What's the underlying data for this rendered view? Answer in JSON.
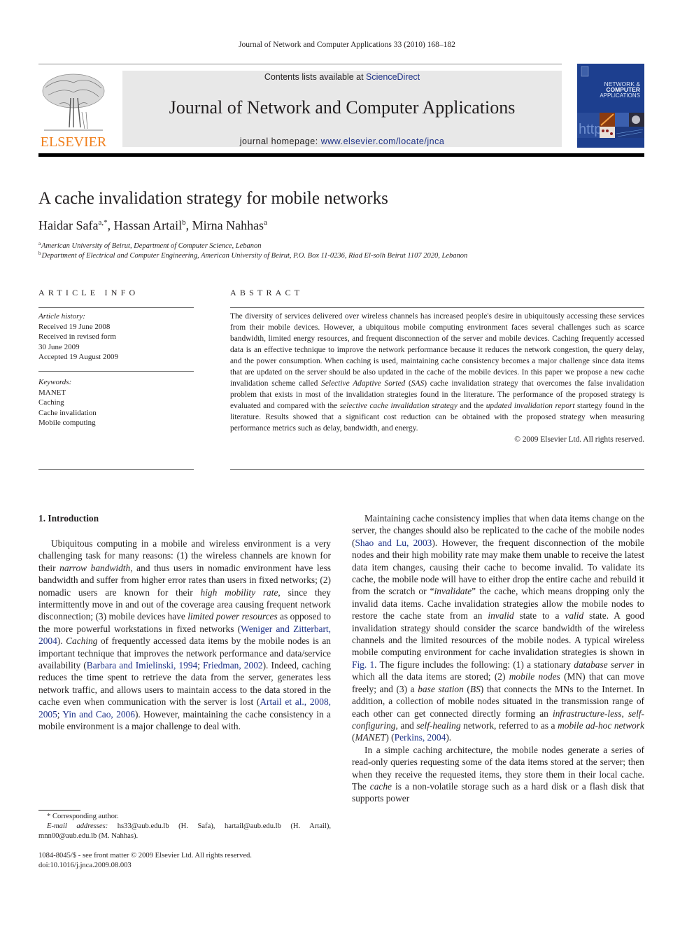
{
  "running_head": "Journal of Network and Computer Applications 33 (2010) 168–182",
  "masthead": {
    "publisher_logo_text": "ELSEVIER",
    "contents_prefix": "Contents lists available at ",
    "contents_link": "ScienceDirect",
    "journal_title": "Journal of Network and Computer Applications",
    "homepage_prefix": "journal homepage: ",
    "homepage_link": "www.elsevier.com/locate/jnca",
    "cover": {
      "line1": "NETWORK &",
      "line2": "COMPUTER",
      "line3": "APPLICATIONS"
    }
  },
  "article": {
    "title": "A cache invalidation strategy for mobile networks",
    "authors": [
      {
        "name": "Haidar Safa",
        "sup": "a,*",
        "sep": ", "
      },
      {
        "name": "Hassan Artail",
        "sup": "b",
        "sep": ", "
      },
      {
        "name": "Mirna Nahhas",
        "sup": "a",
        "sep": ""
      }
    ],
    "affiliations": [
      {
        "mark": "a",
        "text": "American University of Beirut, Department of Computer Science, Lebanon"
      },
      {
        "mark": "b",
        "text": "Department of Electrical and Computer Engineering, American University of Beirut, P.O. Box 11-0236, Riad El-solh Beirut 1107 2020, Lebanon"
      }
    ]
  },
  "article_info": {
    "heading": "ARTICLE INFO",
    "history_label": "Article history:",
    "history": [
      "Received 19 June 2008",
      "Received in revised form",
      "30 June 2009",
      "Accepted 19 August 2009"
    ],
    "keywords_label": "Keywords:",
    "keywords": [
      "MANET",
      "Caching",
      "Cache invalidation",
      "Mobile computing"
    ]
  },
  "abstract": {
    "heading": "ABSTRACT",
    "segments": [
      {
        "t": "The diversity of services delivered over wireless channels has increased people's desire in ubiquitously accessing these services from their mobile devices. However, a ubiquitous mobile computing environment faces several challenges such as scarce bandwidth, limited energy resources, and frequent disconnection of the server and mobile devices. Caching frequently accessed data is an effective technique to improve the network performance because it reduces the network congestion, the query delay, and the power consumption. When caching is used, maintaining cache consistency becomes a major challenge since data items that are updated on the server should be also updated in the cache of the mobile devices. In this paper we propose a new cache invalidation scheme called "
      },
      {
        "t": "Selective Adaptive Sorted",
        "i": true
      },
      {
        "t": " ("
      },
      {
        "t": "SAS",
        "i": true
      },
      {
        "t": ") cache invalidation strategy that overcomes the false invalidation problem that exists in most of the invalidation strategies found in the literature. The performance of the proposed strategy is evaluated and compared with the "
      },
      {
        "t": "selective cache invalidation strategy",
        "i": true
      },
      {
        "t": " and the "
      },
      {
        "t": "updated invalidation report",
        "i": true
      },
      {
        "t": " startegy found in the literature. Results showed that a significant cost reduction can be obtained with the proposed strategy when measuring performance metrics such as delay, bandwidth, and energy."
      }
    ],
    "copyright": "© 2009 Elsevier Ltd. All rights reserved."
  },
  "body": {
    "section_heading": "1.  Introduction",
    "left_paragraphs": [
      [
        {
          "t": "Ubiquitous computing in a mobile and wireless environment is a very challenging task for many reasons: (1) the wireless channels are known for their "
        },
        {
          "t": "narrow bandwidth",
          "i": true
        },
        {
          "t": ", and thus users in nomadic environment have less bandwidth and suffer from higher error rates than users in fixed networks; (2) nomadic users are known for their "
        },
        {
          "t": "high mobility rate",
          "i": true
        },
        {
          "t": ", since they intermittently move in and out of the coverage area causing frequent network disconnection; (3) mobile devices have "
        },
        {
          "t": "limited power resources",
          "i": true
        },
        {
          "t": " as opposed to the more powerful workstations in fixed networks ("
        },
        {
          "t": "Weniger and Zitterbart, 2004",
          "link": true
        },
        {
          "t": "). "
        },
        {
          "t": "Caching",
          "i": true
        },
        {
          "t": " of frequently accessed data items by the mobile nodes is an important technique that improves the network performance and data/service availability ("
        },
        {
          "t": "Barbara and Imielinski, 1994",
          "link": true
        },
        {
          "t": "; "
        },
        {
          "t": "Friedman, 2002",
          "link": true
        },
        {
          "t": "). Indeed, caching reduces the time spent to retrieve the data from the server, generates less network traffic, and allows users to maintain access to the data stored in the cache even when communication with the server is lost ("
        },
        {
          "t": "Artail et al., 2008, 2005",
          "link": true
        },
        {
          "t": "; "
        },
        {
          "t": "Yin and Cao, 2006",
          "link": true
        },
        {
          "t": "). However, maintaining the cache consistency in a mobile environment is a major challenge to deal with."
        }
      ]
    ],
    "right_paragraphs": [
      [
        {
          "t": "Maintaining cache consistency implies that when data items change on the server, the changes should also be replicated to the cache of the mobile nodes ("
        },
        {
          "t": "Shao and Lu, 2003",
          "link": true
        },
        {
          "t": "). However, the frequent disconnection of the mobile nodes and their high mobility rate may make them unable to receive the latest data item changes, causing their cache to become invalid. To validate its cache, the mobile node will have to either drop the entire cache and rebuild it from the scratch or “"
        },
        {
          "t": "invalidate",
          "i": true
        },
        {
          "t": "” the cache, which means dropping only the invalid data items. Cache invalidation strategies allow the mobile nodes to restore the cache state from an "
        },
        {
          "t": "invalid",
          "i": true
        },
        {
          "t": " state to a "
        },
        {
          "t": "valid",
          "i": true
        },
        {
          "t": " state. A good invalidation strategy should consider the scarce bandwidth of the wireless channels and the limited resources of the mobile nodes. A typical wireless mobile computing environment for cache invalidation strategies is shown in "
        },
        {
          "t": "Fig. 1",
          "link": true
        },
        {
          "t": ". The figure includes the following: (1) a stationary "
        },
        {
          "t": "database server",
          "i": true
        },
        {
          "t": " in which all the data items are stored; (2) "
        },
        {
          "t": "mobile nodes",
          "i": true
        },
        {
          "t": " (MN) that can move freely; and (3) a "
        },
        {
          "t": "base station",
          "i": true
        },
        {
          "t": " ("
        },
        {
          "t": "BS",
          "i": true
        },
        {
          "t": ") that connects the MNs to the Internet. In addition, a collection of mobile nodes situated in the transmission range of each other can get connected directly forming an "
        },
        {
          "t": "infrastructure-less",
          "i": true
        },
        {
          "t": ", "
        },
        {
          "t": "self-configuring",
          "i": true
        },
        {
          "t": ", and "
        },
        {
          "t": "self-healing",
          "i": true
        },
        {
          "t": " network, referred to as a "
        },
        {
          "t": "mobile ad-hoc network",
          "i": true
        },
        {
          "t": " ("
        },
        {
          "t": "MANET",
          "i": true
        },
        {
          "t": ") ("
        },
        {
          "t": "Perkins, 2004",
          "link": true
        },
        {
          "t": ")."
        }
      ],
      [
        {
          "t": "In a simple caching architecture, the mobile nodes generate a series of read-only queries requesting some of the data items stored at the server; then when they receive the requested items, they store them in their local cache. The "
        },
        {
          "t": "cache",
          "i": true
        },
        {
          "t": " is a non-volatile storage such as a hard disk or a flash disk that supports power"
        }
      ]
    ]
  },
  "footnotes": {
    "corresponding": "* Corresponding author.",
    "email_label": "E-mail addresses:",
    "emails": " hs33@aub.edu.lb (H. Safa), hartail@aub.edu.lb (H. Artail), mnn00@aub.edu.lb (M. Nahhas).",
    "issn_line": "1084-8045/$ - see front matter © 2009 Elsevier Ltd. All rights reserved.",
    "doi": "doi:10.1016/j.jnca.2009.08.003"
  },
  "colors": {
    "link": "#1e3287",
    "elsevier_orange": "#f07f1c",
    "banner_gray": "#e8e8e8",
    "cover_blue": "#1d3f8f"
  }
}
